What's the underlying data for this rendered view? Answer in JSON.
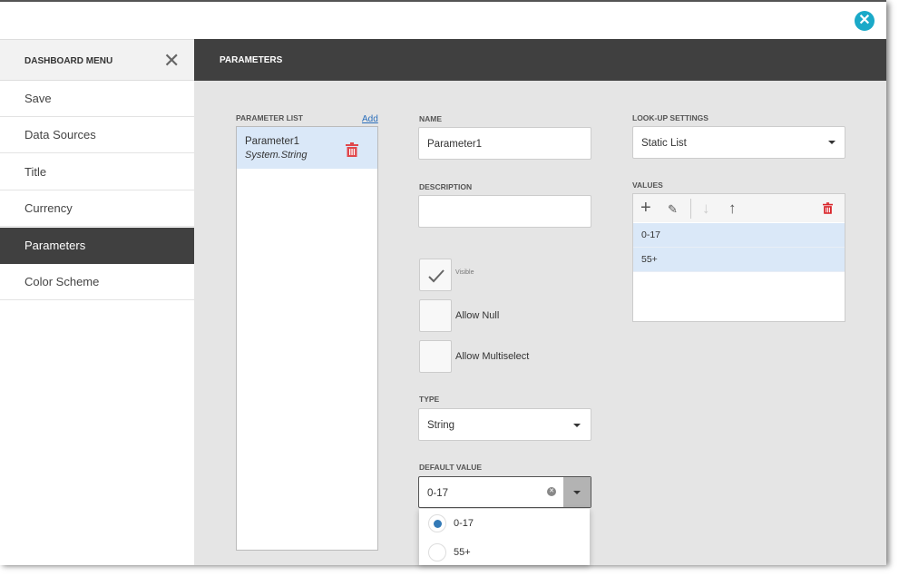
{
  "window": {
    "close_icon": "close-circle-icon",
    "accent": "#1aa9c8"
  },
  "sidebar": {
    "title": "DASHBOARD MENU",
    "items": [
      {
        "label": "Save"
      },
      {
        "label": "Data Sources"
      },
      {
        "label": "Title"
      },
      {
        "label": "Currency"
      },
      {
        "label": "Parameters",
        "active": true
      },
      {
        "label": "Color Scheme"
      }
    ]
  },
  "header": {
    "title": "PARAMETERS"
  },
  "parameter_list": {
    "label": "PARAMETER LIST",
    "add_label": "Add",
    "items": [
      {
        "name": "Parameter1",
        "type": "System.String"
      }
    ]
  },
  "form": {
    "name_label": "NAME",
    "name_value": "Parameter1",
    "description_label": "DESCRIPTION",
    "description_value": "",
    "visible_label": "Visible",
    "visible_checked": true,
    "allow_null_label": "Allow Null",
    "allow_null_checked": false,
    "allow_multiselect_label": "Allow Multiselect",
    "allow_multiselect_checked": false,
    "type_label": "TYPE",
    "type_value": "String",
    "default_label": "DEFAULT VALUE",
    "default_value": "0-17",
    "default_options": [
      {
        "label": "0-17",
        "selected": true
      },
      {
        "label": "55+",
        "selected": false
      }
    ]
  },
  "lookup": {
    "label": "LOOK-UP SETTINGS",
    "value": "Static List",
    "values_label": "VALUES",
    "values": [
      "0-17",
      "55+"
    ]
  },
  "colors": {
    "danger": "#e0474c",
    "selected_row": "#dae8f8",
    "header": "#404040"
  }
}
